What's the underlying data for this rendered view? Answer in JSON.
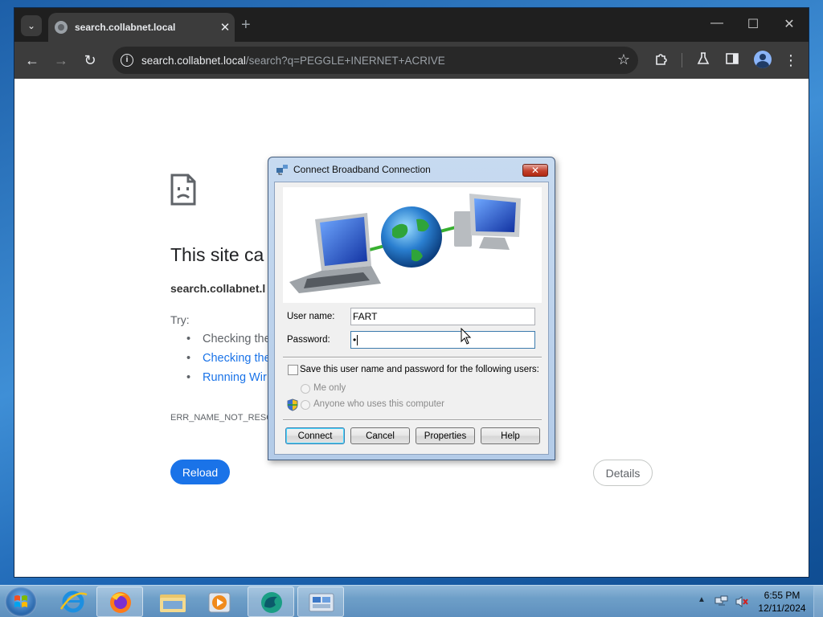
{
  "browser": {
    "tab_title": "search.collabnet.local",
    "tab_close": "✕",
    "new_tab": "+",
    "url_host": "search.collabnet.local",
    "url_path": "/search?q=PEGGLE+INERNET+ACRIVE"
  },
  "error_page": {
    "title": "This site ca",
    "host": "search.collabnet.l",
    "try_label": "Try:",
    "suggestions": [
      {
        "text": "Checking the",
        "link": false
      },
      {
        "text": "Checking the",
        "link": true
      },
      {
        "text": "Running Wir",
        "link": true
      }
    ],
    "error_code": "ERR_NAME_NOT_RESO",
    "reload_label": "Reload",
    "details_label": "Details"
  },
  "dialog": {
    "title": "Connect Broadband Connection",
    "close_label": "✕",
    "username_label": "User name:",
    "username_value": "FART",
    "password_label": "Password:",
    "password_value": "•",
    "save_checkbox_label": "Save this user name and password for the following users:",
    "save_checked": false,
    "option_me_only": "Me only",
    "option_anyone": "Anyone who uses this computer",
    "buttons": {
      "connect": "Connect",
      "cancel": "Cancel",
      "properties": "Properties",
      "help": "Help"
    }
  },
  "taskbar": {
    "apps": [
      "internet-explorer",
      "firefox",
      "file-explorer",
      "media-player",
      "browser-app",
      "network-connections"
    ],
    "time": "6:55 PM",
    "date": "12/11/2024"
  },
  "colors": {
    "chrome_dark": "#3c3c3c",
    "reload_blue": "#1a73e8",
    "dialog_frame": "#c7daf0"
  }
}
